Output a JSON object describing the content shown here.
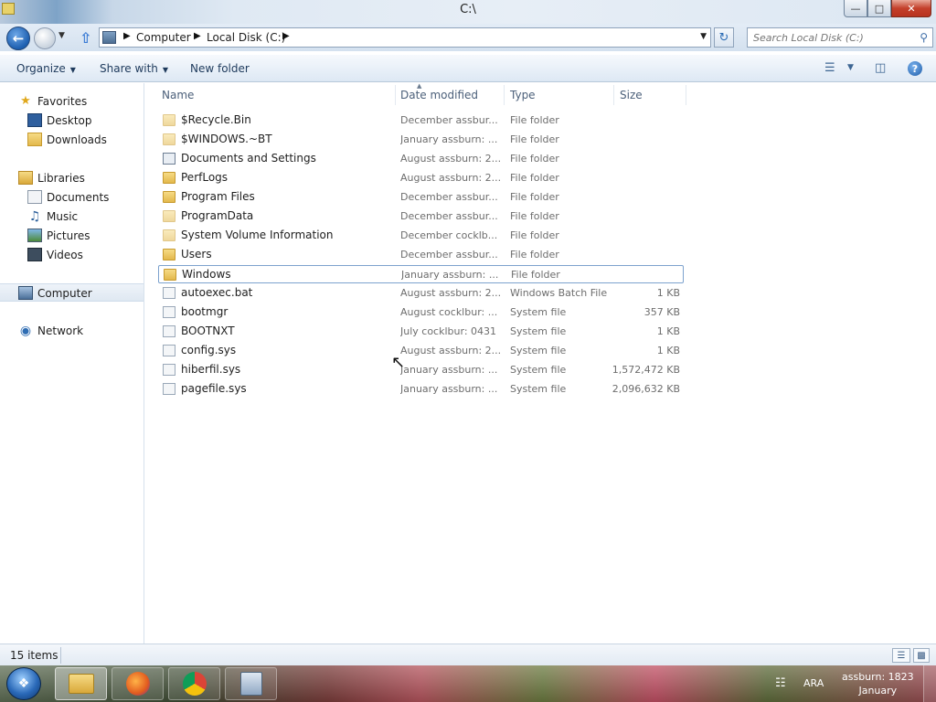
{
  "window": {
    "title": "C:\\",
    "buttons": {
      "minimize": "—",
      "maximize": "□",
      "close": "✕"
    }
  },
  "address": {
    "crumbs": [
      "Computer",
      "Local Disk (C:)"
    ],
    "search_placeholder": "Search Local Disk (C:)"
  },
  "toolbar": {
    "organize": "Organize",
    "share_with": "Share with",
    "new_folder": "New folder"
  },
  "nav": {
    "favorites": "Favorites",
    "desktop": "Desktop",
    "downloads": "Downloads",
    "libraries": "Libraries",
    "documents": "Documents",
    "music": "Music",
    "pictures": "Pictures",
    "videos": "Videos",
    "computer": "Computer",
    "network": "Network"
  },
  "columns": {
    "name": "Name",
    "date": "Date modified",
    "type": "Type",
    "size": "Size"
  },
  "files": [
    {
      "name": "$Recycle.Bin",
      "date": "December assbur...",
      "type": "File folder",
      "size": "",
      "icon": "folder-faded"
    },
    {
      "name": "$WINDOWS.~BT",
      "date": "January assburn: ...",
      "type": "File folder",
      "size": "",
      "icon": "folder-faded"
    },
    {
      "name": "Documents and Settings",
      "date": "August assburn: 2...",
      "type": "File folder",
      "size": "",
      "icon": "shortcut-folder"
    },
    {
      "name": "PerfLogs",
      "date": "August assburn: 2...",
      "type": "File folder",
      "size": "",
      "icon": "folder"
    },
    {
      "name": "Program Files",
      "date": "December assbur...",
      "type": "File folder",
      "size": "",
      "icon": "folder"
    },
    {
      "name": "ProgramData",
      "date": "December assbur...",
      "type": "File folder",
      "size": "",
      "icon": "folder-faded"
    },
    {
      "name": "System Volume Information",
      "date": "December cocklb...",
      "type": "File folder",
      "size": "",
      "icon": "folder-faded"
    },
    {
      "name": "Users",
      "date": "December assbur...",
      "type": "File folder",
      "size": "",
      "icon": "folder"
    },
    {
      "name": "Windows",
      "date": "January assburn: ...",
      "type": "File folder",
      "size": "",
      "icon": "folder"
    },
    {
      "name": "autoexec.bat",
      "date": "August assburn: 2...",
      "type": "Windows Batch File",
      "size": "1 KB",
      "icon": "file"
    },
    {
      "name": "bootmgr",
      "date": "August cocklbur: ...",
      "type": "System file",
      "size": "357 KB",
      "icon": "file"
    },
    {
      "name": "BOOTNXT",
      "date": "July cocklbur: 0431",
      "type": "System file",
      "size": "1 KB",
      "icon": "file"
    },
    {
      "name": "config.sys",
      "date": "August assburn: 2...",
      "type": "System file",
      "size": "1 KB",
      "icon": "file"
    },
    {
      "name": "hiberfil.sys",
      "date": "January assburn: ...",
      "type": "System file",
      "size": "1,572,472 KB",
      "icon": "file"
    },
    {
      "name": "pagefile.sys",
      "date": "January assburn: ...",
      "type": "System file",
      "size": "2,096,632 KB",
      "icon": "file"
    }
  ],
  "status": {
    "item_count": "15 items"
  },
  "taskbar": {
    "language": "ARA",
    "time": "assburn: 1823",
    "date": "January"
  }
}
